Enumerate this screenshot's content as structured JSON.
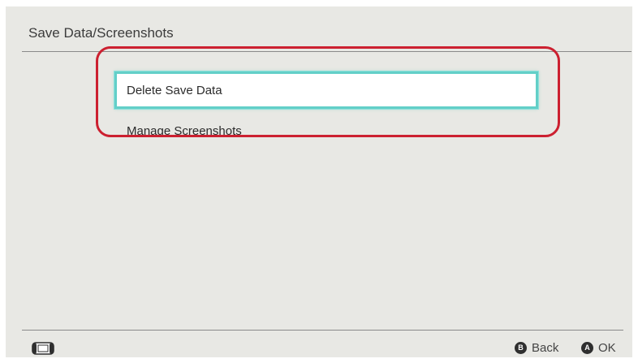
{
  "header": {
    "title": "Save Data/Screenshots"
  },
  "menu": {
    "items": [
      {
        "label": "Delete Save Data",
        "selected": true
      },
      {
        "label": "Manage Screenshots",
        "selected": false
      }
    ],
    "selection_color": "#63cfc8"
  },
  "annotation": {
    "highlight_color": "#cc2030"
  },
  "footer": {
    "console_icon": "handheld-console-icon",
    "actions": [
      {
        "button": "B",
        "label": "Back",
        "icon": "b-button-icon"
      },
      {
        "button": "A",
        "label": "OK",
        "icon": "a-button-icon"
      }
    ]
  }
}
